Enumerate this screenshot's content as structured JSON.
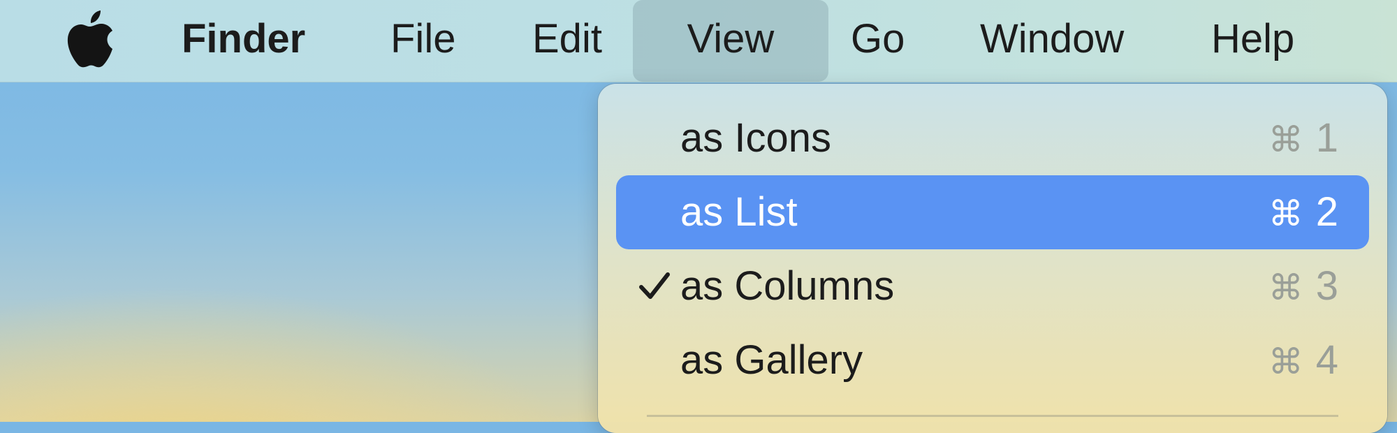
{
  "menubar": {
    "apple_icon": "apple-logo-icon",
    "items": [
      {
        "label": "Finder"
      },
      {
        "label": "File"
      },
      {
        "label": "Edit"
      },
      {
        "label": "View"
      },
      {
        "label": "Go"
      },
      {
        "label": "Window"
      },
      {
        "label": "Help"
      }
    ],
    "open_menu": "View"
  },
  "dropdown": {
    "items": [
      {
        "label": "as Icons",
        "shortcut_key": "1",
        "checked": false,
        "highlighted": false
      },
      {
        "label": "as List",
        "shortcut_key": "2",
        "checked": false,
        "highlighted": true
      },
      {
        "label": "as Columns",
        "shortcut_key": "3",
        "checked": true,
        "highlighted": false
      },
      {
        "label": "as Gallery",
        "shortcut_key": "4",
        "checked": false,
        "highlighted": false
      }
    ],
    "command_symbol": "⌘",
    "check_icon": "checkmark-icon"
  },
  "colors": {
    "highlight": "#5a93f3",
    "shortcut_dim": "#9a9f98",
    "text": "#1c1c1c"
  }
}
